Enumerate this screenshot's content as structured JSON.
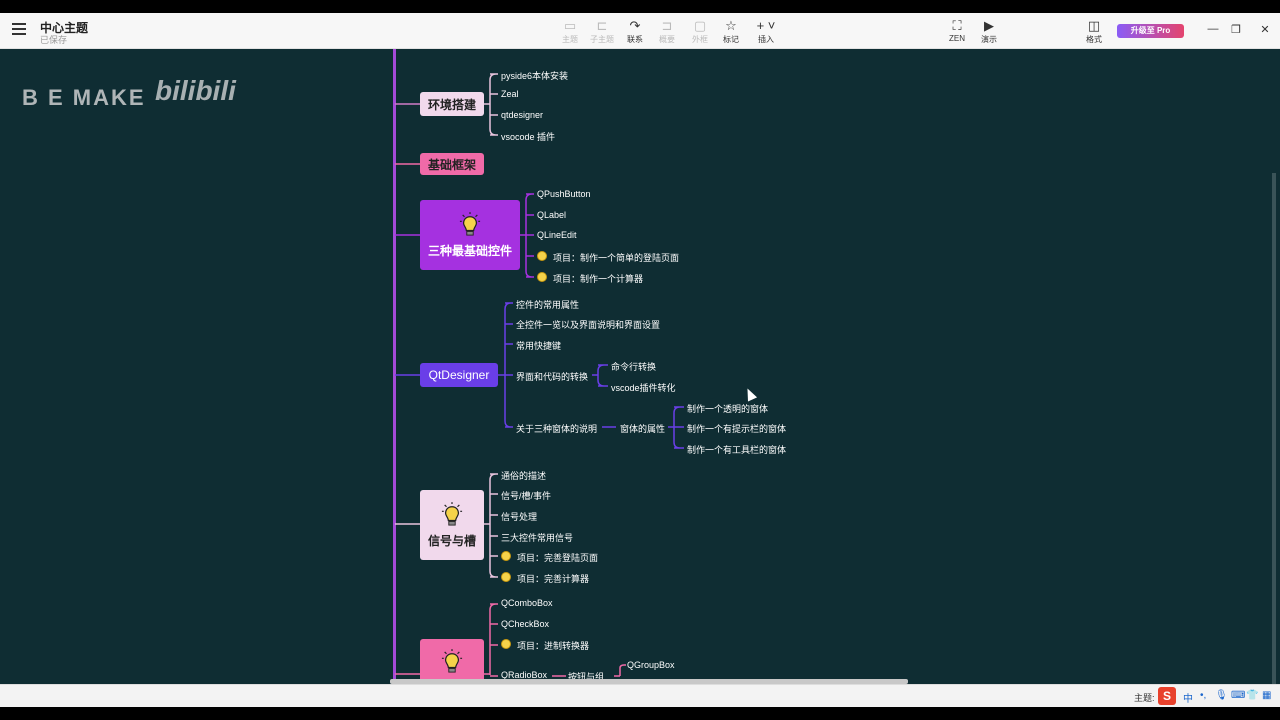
{
  "app": {
    "title": "中心主题",
    "subtitle": "已保存"
  },
  "toolbar": {
    "items": [
      {
        "label": "主题",
        "icon": "topic-icon",
        "enabled": false
      },
      {
        "label": "子主题",
        "icon": "subtopic-icon",
        "enabled": false
      },
      {
        "label": "联系",
        "icon": "relationship-icon",
        "enabled": true
      },
      {
        "label": "概要",
        "icon": "summary-icon",
        "enabled": false
      },
      {
        "label": "外框",
        "icon": "boundary-icon",
        "enabled": false
      },
      {
        "label": "标记",
        "icon": "star-icon",
        "enabled": true
      },
      {
        "label": "插入",
        "icon": "plus-icon",
        "enabled": true
      }
    ],
    "zen_label": "ZEN",
    "present_label": "演示",
    "format_label": "格式",
    "pro_label": "升级至 Pro"
  },
  "watermark": {
    "text1": "B E MAKE",
    "text2": "bilibili"
  },
  "mindmap": {
    "branches": [
      {
        "label": "环境搭建",
        "children": [
          "pyside6本体安装",
          "Zeal",
          "qtdesigner",
          "vsocode 插件"
        ]
      },
      {
        "label": "基础框架",
        "children": []
      },
      {
        "label": "三种最基础控件",
        "children": [
          "QPushButton",
          "QLabel",
          "QLineEdit",
          "项目：制作一个简单的登陆页面",
          "项目：制作一个计算器"
        ]
      },
      {
        "label": "QtDesigner",
        "children": [
          "控件的常用属性",
          "全控件一览以及界面说明和界面设置",
          "常用快捷键",
          "界面和代码的转换",
          "关于三种窗体的说明"
        ],
        "sub": {
          "conversion": [
            "命令行转换",
            "vscode插件转化"
          ],
          "window_attr": "窗体的属性",
          "window_items": [
            "制作一个透明的窗体",
            "制作一个有提示栏的窗体",
            "制作一个有工具栏的窗体"
          ]
        }
      },
      {
        "label": "信号与槽",
        "children": [
          "通俗的描述",
          "信号/槽/事件",
          "信号处理",
          "三大控件常用信号",
          "项目：完善登陆页面",
          "项目：完善计算器"
        ]
      },
      {
        "label": "",
        "children": [
          "QComboBox",
          "QCheckBox",
          "项目：进制转换器",
          "QRadioBox"
        ],
        "sub": {
          "group_label": "按钮与组",
          "group_items": [
            "QGroupBox"
          ]
        }
      }
    ]
  },
  "statusbar": {
    "theme_label": "主题:",
    "ime_text": "中"
  },
  "colors": {
    "canvas_bg": "#0f2d33",
    "trunk": "#a54ad8",
    "branch_env_bg": "#f1d9ec",
    "branch_base_bg": "#f06aa8",
    "branch_controls_bg": "#a531e0",
    "branch_qtdesigner_bg": "#6a3ee8",
    "branch_signal_bg": "#f1d9ec",
    "branch_next_bg": "#f06aa8",
    "pro_gradient_start": "#8a5cf6",
    "pro_gradient_end": "#e4446e"
  }
}
